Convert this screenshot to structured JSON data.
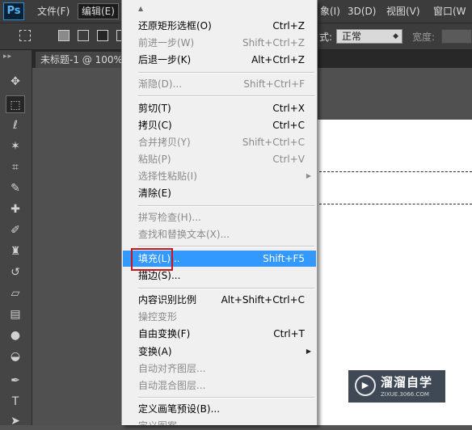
{
  "menubar": {
    "logo": "Ps",
    "items": [
      {
        "label": "文件(F)"
      },
      {
        "label": "编辑(E)"
      },
      {
        "label": "象(I)"
      },
      {
        "label": "3D(D)"
      },
      {
        "label": "视图(V)"
      },
      {
        "label": "窗口(W"
      }
    ]
  },
  "options": {
    "style_label": "式:",
    "style_value": "正常",
    "width_label": "宽度:"
  },
  "document_tab": {
    "title": "未标题-1 @ 100%"
  },
  "edit_menu": {
    "items": [
      {
        "label": "还原矩形选框(O)",
        "shortcut": "Ctrl+Z",
        "enabled": true
      },
      {
        "label": "前进一步(W)",
        "shortcut": "Shift+Ctrl+Z",
        "enabled": false
      },
      {
        "label": "后退一步(K)",
        "shortcut": "Alt+Ctrl+Z",
        "enabled": true
      },
      {
        "label": "渐隐(D)...",
        "shortcut": "Shift+Ctrl+F",
        "enabled": false
      },
      {
        "label": "剪切(T)",
        "shortcut": "Ctrl+X",
        "enabled": true
      },
      {
        "label": "拷贝(C)",
        "shortcut": "Ctrl+C",
        "enabled": true
      },
      {
        "label": "合并拷贝(Y)",
        "shortcut": "Shift+Ctrl+C",
        "enabled": false
      },
      {
        "label": "粘贴(P)",
        "shortcut": "Ctrl+V",
        "enabled": false
      },
      {
        "label": "选择性粘贴(I)",
        "shortcut": "",
        "enabled": false
      },
      {
        "label": "清除(E)",
        "shortcut": "",
        "enabled": true
      },
      {
        "label": "拼写检查(H)...",
        "shortcut": "",
        "enabled": false
      },
      {
        "label": "查找和替换文本(X)...",
        "shortcut": "",
        "enabled": false
      },
      {
        "label": "填充(L)...",
        "shortcut": "Shift+F5",
        "enabled": true,
        "highlighted": true
      },
      {
        "label": "描边(S)...",
        "shortcut": "",
        "enabled": true
      },
      {
        "label": "内容识别比例",
        "shortcut": "Alt+Shift+Ctrl+C",
        "enabled": true
      },
      {
        "label": "操控变形",
        "shortcut": "",
        "enabled": false
      },
      {
        "label": "自由变换(F)",
        "shortcut": "Ctrl+T",
        "enabled": true
      },
      {
        "label": "变换(A)",
        "shortcut": "",
        "enabled": true
      },
      {
        "label": "自动对齐图层...",
        "shortcut": "",
        "enabled": false
      },
      {
        "label": "自动混合图层...",
        "shortcut": "",
        "enabled": false
      },
      {
        "label": "定义画笔预设(B)...",
        "shortcut": "",
        "enabled": true
      },
      {
        "label": "定义图案...",
        "shortcut": "",
        "enabled": false
      }
    ]
  },
  "watermark": {
    "title": "溜溜自学",
    "url": "ZIXUE.3066.COM"
  },
  "colors": {
    "highlight": "#3399ff",
    "annotation_box": "#c8161d",
    "menubar_bg": "#3c3c3c",
    "panel_bg": "#535353"
  }
}
